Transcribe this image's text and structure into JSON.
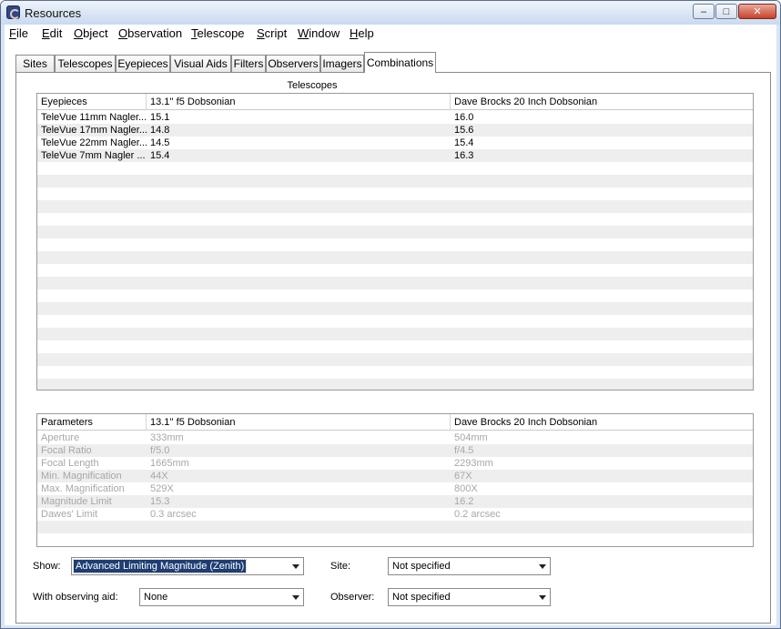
{
  "window": {
    "title": "Resources"
  },
  "menu": [
    {
      "pre": "",
      "ul": "F",
      "post": "ile"
    },
    {
      "pre": "",
      "ul": "E",
      "post": "dit"
    },
    {
      "pre": "",
      "ul": "O",
      "post": "bject"
    },
    {
      "pre": "",
      "ul": "O",
      "post": "bservation"
    },
    {
      "pre": "",
      "ul": "T",
      "post": "elescope"
    },
    {
      "pre": "",
      "ul": "S",
      "post": "cript"
    },
    {
      "pre": "",
      "ul": "W",
      "post": "indow"
    },
    {
      "pre": "",
      "ul": "H",
      "post": "elp"
    }
  ],
  "tabs": [
    "Sites",
    "Telescopes",
    "Eyepieces",
    "Visual Aids",
    "Filters",
    "Observers",
    "Imagers",
    "Combinations"
  ],
  "active_tab": "Combinations",
  "combinations": {
    "caption": "Telescopes",
    "headers": [
      "Eyepieces",
      "13.1'' f5 Dobsonian",
      "Dave Brocks 20 Inch Dobsonian"
    ],
    "rows": [
      [
        "TeleVue 11mm Nagler...",
        "15.1",
        "16.0"
      ],
      [
        "TeleVue 17mm Nagler...",
        "14.8",
        "15.6"
      ],
      [
        "TeleVue 22mm Nagler...",
        "14.5",
        "15.4"
      ],
      [
        "TeleVue 7mm Nagler ...",
        "15.4",
        "16.3"
      ]
    ]
  },
  "parameters": {
    "headers": [
      "Parameters",
      "13.1'' f5 Dobsonian",
      "Dave Brocks 20 Inch Dobsonian"
    ],
    "rows": [
      [
        "Aperture",
        "333mm",
        "504mm"
      ],
      [
        "Focal Ratio",
        "f/5.0",
        "f/4.5"
      ],
      [
        "Focal Length",
        "1665mm",
        "2293mm"
      ],
      [
        "Min. Magnification",
        "44X",
        "67X"
      ],
      [
        "Max. Magnification",
        "529X",
        "800X"
      ],
      [
        "Magnitude Limit",
        "15.3",
        "16.2"
      ],
      [
        "Dawes' Limit",
        "0.3 arcsec",
        "0.2 arcsec"
      ]
    ]
  },
  "controls": {
    "show_label": "Show:",
    "show_value": "Advanced Limiting Magnitude (Zenith)",
    "aid_label": "With observing aid:",
    "aid_value": "None",
    "site_label": "Site:",
    "site_value": "Not specified",
    "observer_label": "Observer:",
    "observer_value": "Not specified"
  }
}
